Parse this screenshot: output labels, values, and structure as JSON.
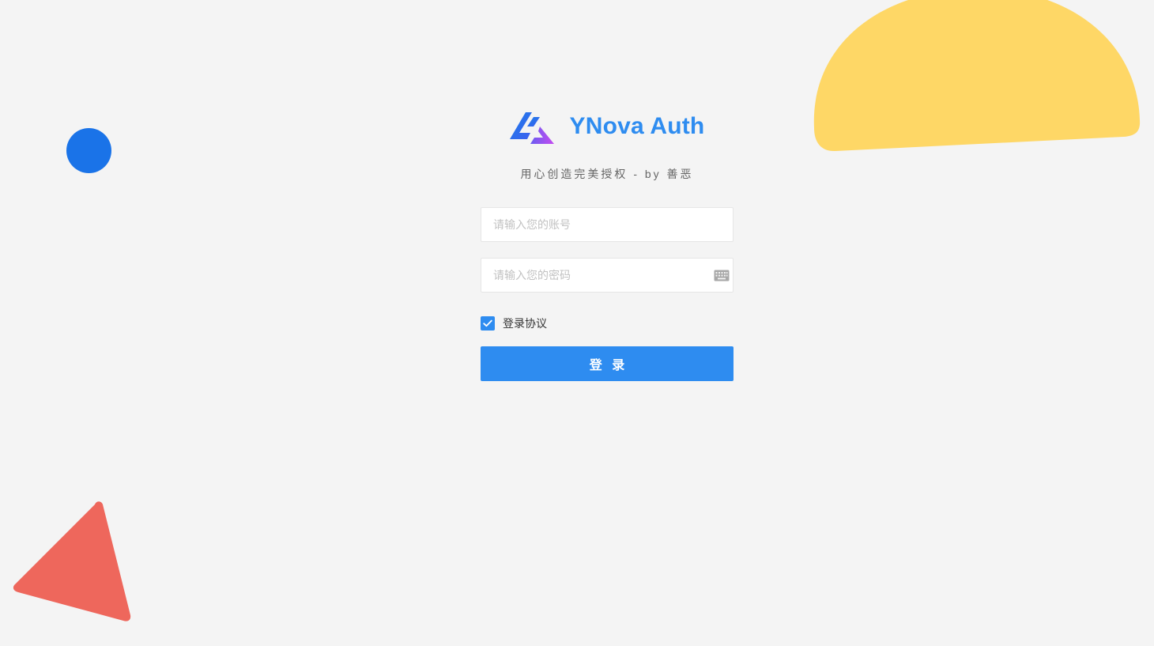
{
  "brand": {
    "name": "YNova Auth",
    "slogan": "用心创造完美授权 - by 善恶",
    "logo_icon": "ynova-logo-icon"
  },
  "form": {
    "username_placeholder": "请输入您的账号",
    "username_value": "",
    "password_placeholder": "请输入您的密码",
    "password_value": "",
    "keyboard_icon": "keyboard-icon",
    "agreement_label": "登录协议",
    "agreement_checked": true,
    "submit_label": "登 录"
  },
  "colors": {
    "accent": "#2e8cf0",
    "background": "#f4f4f4",
    "deco_circle": "#1a73e8",
    "deco_semicircle": "#fed766",
    "deco_triangle": "#ee675c"
  }
}
